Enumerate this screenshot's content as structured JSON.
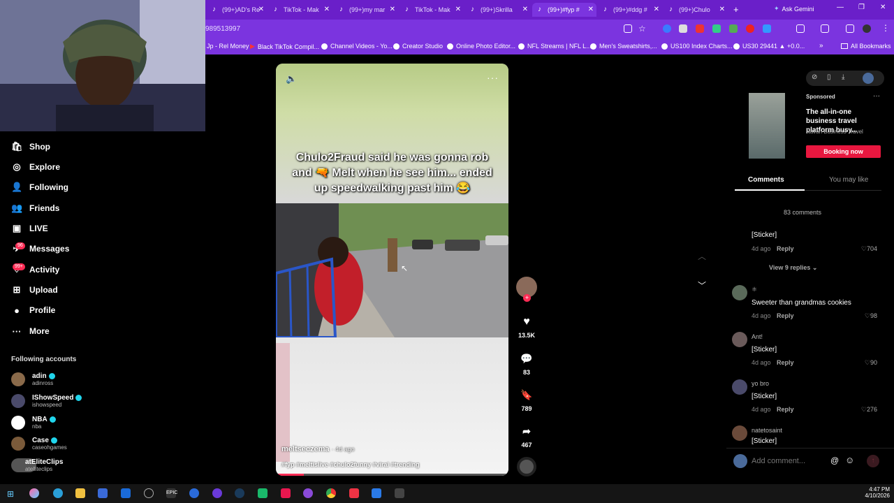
{
  "browser": {
    "tabs": [
      {
        "label": "(99+)AD's Re"
      },
      {
        "label": "TikTok - Mak"
      },
      {
        "label": "(99+)my mar"
      },
      {
        "label": "TikTok - Mak"
      },
      {
        "label": "(99+)Skrilla"
      },
      {
        "label": "(99+)#fyp #"
      },
      {
        "label": "(99+)#ddg #"
      },
      {
        "label": "(99+)Chulo"
      }
    ],
    "new_tab_label": "+",
    "ask_gemini": "Ask Gemini",
    "url": "989513997",
    "bookmarks": [
      {
        "label": "Jp - Rel Money"
      },
      {
        "label": "Black TikTok Compil..."
      },
      {
        "label": "Channel Videos - Yo..."
      },
      {
        "label": "Creator Studio"
      },
      {
        "label": "Online Photo Editor..."
      },
      {
        "label": "NFL Streams | NFL L..."
      },
      {
        "label": "Men's Sweatshirts,..."
      },
      {
        "label": "US100 Index Charts..."
      },
      {
        "label": "US30 29441 ▲ +0.0..."
      }
    ],
    "all_bookmarks": "All Bookmarks"
  },
  "sidebar": {
    "items": [
      {
        "label": "Shop",
        "icon": "shop-icon"
      },
      {
        "label": "Explore",
        "icon": "compass-icon"
      },
      {
        "label": "Following",
        "icon": "following-icon"
      },
      {
        "label": "Friends",
        "icon": "friends-icon"
      },
      {
        "label": "LIVE",
        "icon": "live-icon"
      },
      {
        "label": "Messages",
        "icon": "messages-icon",
        "badge": "96"
      },
      {
        "label": "Activity",
        "icon": "activity-icon",
        "badge": "99+"
      },
      {
        "label": "Upload",
        "icon": "upload-icon"
      },
      {
        "label": "Profile",
        "icon": "profile-icon"
      },
      {
        "label": "More",
        "icon": "more-icon"
      }
    ],
    "following_header": "Following accounts",
    "accounts": [
      {
        "name": "adin",
        "handle": "adinross"
      },
      {
        "name": "IShowSpeed",
        "handle": "ishowspeed"
      },
      {
        "name": "NBA",
        "handle": "nba"
      },
      {
        "name": "Case",
        "handle": "caseohgames"
      },
      {
        "name": "atEliteClips",
        "handle": "atelliteclips"
      }
    ]
  },
  "video": {
    "overlay_text": "Chulo2Fraud said he was gonna rob and 🔫 Melt when he see him... ended up speedwalking past him 😂",
    "author": "meltseczema",
    "age": "· 4d ago",
    "hashtags": "#fyp #meltislive #chulo2funny #viral #trending",
    "likes": "13.5K",
    "comments": "83",
    "saves": "789",
    "shares": "467"
  },
  "ad": {
    "sponsored": "Sponsored",
    "title": "The all-in-one business travel platform busy...",
    "advertiser": "Navan Business Travel",
    "cta": "Booking now"
  },
  "panel": {
    "tab_comments": "Comments",
    "tab_you_may_like": "You may like",
    "comment_count": "83 comments",
    "view_replies": "View 9 replies",
    "reply_label": "Reply",
    "comments": [
      {
        "user": "",
        "text": "[Sticker]",
        "age": "4d ago",
        "likes": "704"
      },
      {
        "user": "",
        "text": "Sweeter than grandmas cookies",
        "age": "4d ago",
        "likes": "98"
      },
      {
        "user": "Ant!",
        "text": "[Sticker]",
        "age": "4d ago",
        "likes": "90"
      },
      {
        "user": "yo bro",
        "text": "[Sticker]",
        "age": "4d ago",
        "likes": "276"
      },
      {
        "user": "natetosaint",
        "text": "[Sticker]",
        "age": "",
        "likes": ""
      }
    ],
    "add_comment_placeholder": "Add comment..."
  },
  "taskbar": {
    "time": "4:47 PM",
    "date": "4/10/2026"
  },
  "colors": {
    "accent": "#fe2c55",
    "browser_purple": "#7b34df",
    "verified": "#20d5ec"
  }
}
